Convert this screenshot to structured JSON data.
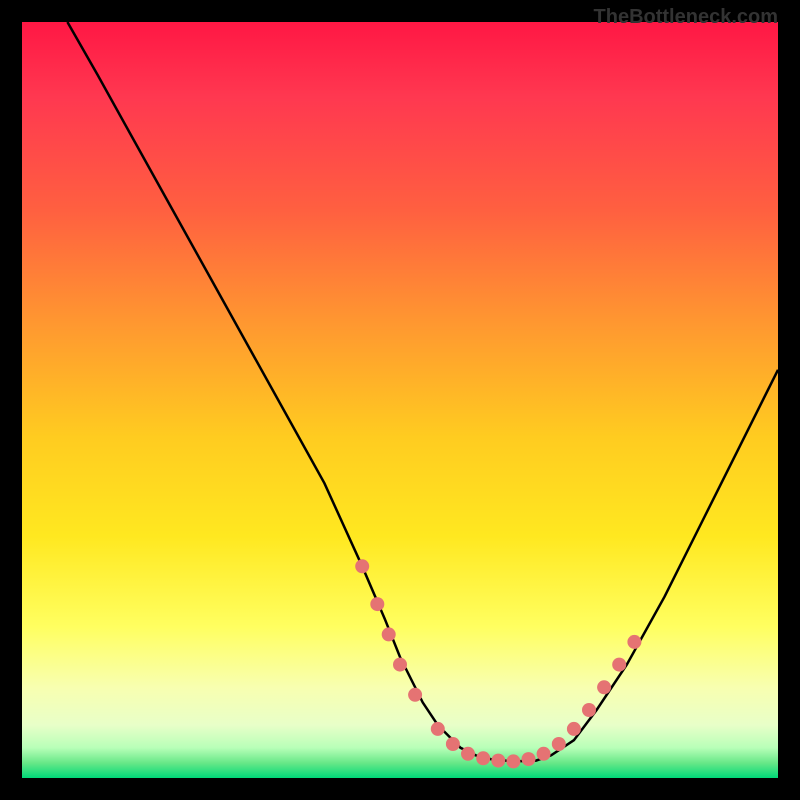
{
  "watermark": "TheBottleneck.com",
  "chart_data": {
    "type": "line",
    "title": "",
    "xlabel": "",
    "ylabel": "",
    "x_range": [
      0,
      100
    ],
    "y_range": [
      0,
      100
    ],
    "series": [
      {
        "name": "curve",
        "color": "#000000",
        "x": [
          6,
          10,
          15,
          20,
          25,
          30,
          35,
          40,
          45,
          48,
          50,
          53,
          55,
          58,
          60,
          62,
          65,
          68,
          70,
          73,
          76,
          80,
          85,
          90,
          95,
          100
        ],
        "y": [
          100,
          93,
          84,
          75,
          66,
          57,
          48,
          39,
          28,
          21,
          16,
          10,
          7,
          4,
          3,
          2.5,
          2.2,
          2.3,
          3,
          5,
          9,
          15,
          24,
          34,
          44,
          54
        ]
      }
    ],
    "markers": {
      "color": "#e57373",
      "radius": 7,
      "points": [
        {
          "x": 45,
          "y": 28
        },
        {
          "x": 47,
          "y": 23
        },
        {
          "x": 48.5,
          "y": 19
        },
        {
          "x": 50,
          "y": 15
        },
        {
          "x": 52,
          "y": 11
        },
        {
          "x": 55,
          "y": 6.5
        },
        {
          "x": 57,
          "y": 4.5
        },
        {
          "x": 59,
          "y": 3.2
        },
        {
          "x": 61,
          "y": 2.6
        },
        {
          "x": 63,
          "y": 2.3
        },
        {
          "x": 65,
          "y": 2.2
        },
        {
          "x": 67,
          "y": 2.5
        },
        {
          "x": 69,
          "y": 3.2
        },
        {
          "x": 71,
          "y": 4.5
        },
        {
          "x": 73,
          "y": 6.5
        },
        {
          "x": 75,
          "y": 9
        },
        {
          "x": 77,
          "y": 12
        },
        {
          "x": 79,
          "y": 15
        },
        {
          "x": 81,
          "y": 18
        }
      ]
    }
  }
}
